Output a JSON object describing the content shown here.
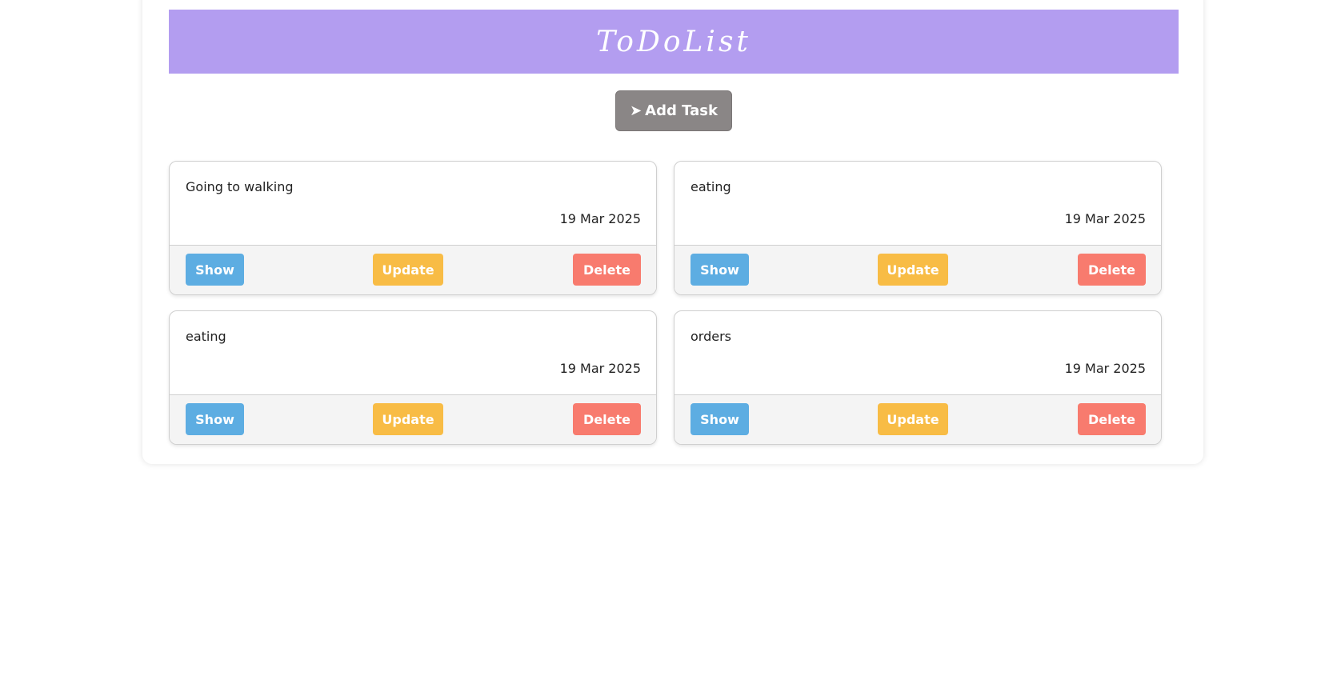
{
  "header": {
    "title": "ToDoList"
  },
  "add_task_button": {
    "icon": "➤",
    "label": "Add Task"
  },
  "tasks": [
    {
      "text": "Going to walking",
      "date": "19 Mar 2025",
      "show_label": "Show",
      "update_label": "Update",
      "delete_label": "Delete"
    },
    {
      "text": "eating",
      "date": "19 Mar 2025",
      "show_label": "Show",
      "update_label": "Update",
      "delete_label": "Delete"
    },
    {
      "text": "eating",
      "date": "19 Mar 2025",
      "show_label": "Show",
      "update_label": "Update",
      "delete_label": "Delete"
    },
    {
      "text": "orders",
      "date": "19 Mar 2025",
      "show_label": "Show",
      "update_label": "Update",
      "delete_label": "Delete"
    }
  ],
  "colors": {
    "header_bg": "#b39df0",
    "add_button_bg": "#8a8686",
    "show_button_bg": "#5dade2",
    "update_button_bg": "#f8bc45",
    "delete_button_bg": "#f87b6e"
  }
}
